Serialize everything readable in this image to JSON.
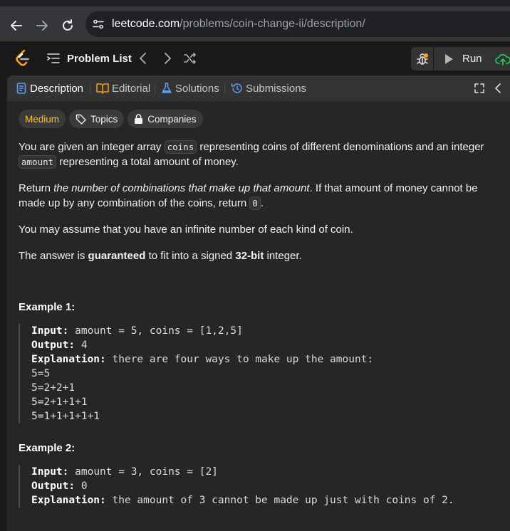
{
  "browser": {
    "url_host": "leetcode.com",
    "url_path": "/problems/coin-change-ii/description/"
  },
  "nav": {
    "problem_list": "Problem List",
    "run": "Run"
  },
  "tabs": [
    {
      "label": "Description"
    },
    {
      "label": "Editorial"
    },
    {
      "label": "Solutions"
    },
    {
      "label": "Submissions"
    }
  ],
  "chips": {
    "difficulty": "Medium",
    "topics": "Topics",
    "companies": "Companies"
  },
  "problem": {
    "p1_a": "You are given an integer array ",
    "p1_code1": "coins",
    "p1_b": " representing coins of different denominations and an integer ",
    "p1_code2": "amount",
    "p1_c": " representing a total amount of money.",
    "p2_a": "Return ",
    "p2_em": "the number of combinations that make up that amount",
    "p2_b": ". If that amount of money cannot be made up by any combination of the coins, return ",
    "p2_code": "0",
    "p2_c": ".",
    "p3": "You may assume that you have an infinite number of each kind of coin.",
    "p4_a": "The answer is ",
    "p4_b1": "guaranteed",
    "p4_c": " to fit into a signed ",
    "p4_b2": "32-bit",
    "p4_d": " integer."
  },
  "examples": [
    {
      "title": "Example 1:",
      "input_label": "Input:",
      "input": "amount = 5, coins = [1,2,5]",
      "output_label": "Output:",
      "output": "4",
      "explanation_label": "Explanation:",
      "explanation": "there are four ways to make up the amount:",
      "lines": [
        "5=5",
        "5=2+2+1",
        "5=2+1+1+1",
        "5=1+1+1+1+1"
      ]
    },
    {
      "title": "Example 2:",
      "input_label": "Input:",
      "input": "amount = 3, coins = [2]",
      "output_label": "Output:",
      "output": "0",
      "explanation_label": "Explanation:",
      "explanation": "the amount of 3 cannot be made up just with coins of 2."
    }
  ],
  "colors": {
    "difficulty_medium": "#ffc01e",
    "accent_blue": "#5a9cf8",
    "run_green": "#2cbb5d"
  }
}
